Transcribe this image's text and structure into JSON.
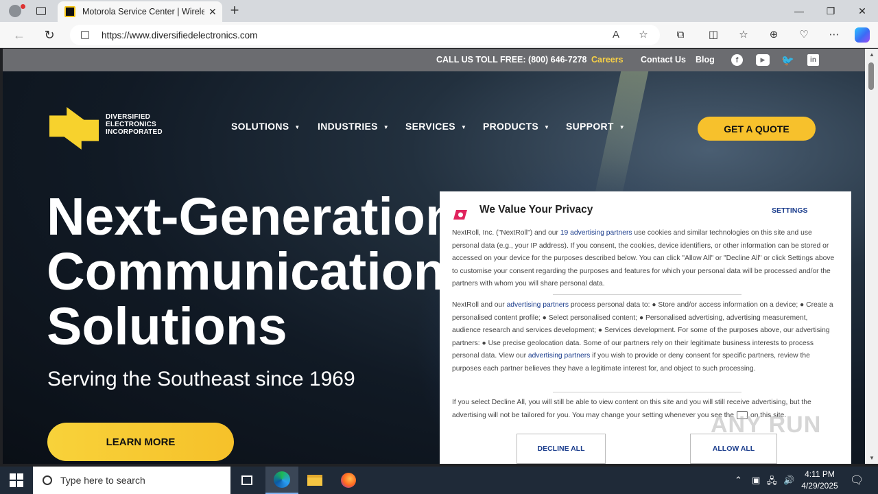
{
  "browser": {
    "tab_title": "Motorola Service Center | Wireless",
    "url": "https://www.diversifiedelectronics.com"
  },
  "site": {
    "topbar": {
      "call": "CALL US TOLL FREE: (800) 646-7278",
      "careers": "Careers",
      "contact": "Contact Us",
      "blog": "Blog"
    },
    "logo_lines": [
      "DIVERSIFIED",
      "ELECTRONICS",
      "INCORPORATED"
    ],
    "nav": [
      "SOLUTIONS",
      "INDUSTRIES",
      "SERVICES",
      "PRODUCTS",
      "SUPPORT"
    ],
    "quote": "GET A QUOTE",
    "headline": [
      "Next-Generation",
      "Communication",
      "Solutions"
    ],
    "subline": "Serving the Southeast since 1969",
    "learn_more": "LEARN MORE"
  },
  "privacy": {
    "title": "We Value Your Privacy",
    "settings": "SETTINGS",
    "p1_a": "NextRoll, Inc. (\"NextRoll\") and our ",
    "p1_link": "19 advertising partners",
    "p1_b": " use cookies and similar technologies on this site and use personal data (e.g., your IP address). If you consent, the cookies, device identifiers, or other information can be stored or accessed on your device for the purposes described below. You can click \"Allow All\" or \"Decline All\" or click Settings above to customise your consent regarding the purposes and features for which your personal data will be processed and/or the partners with whom you will share personal data.",
    "p2_a": "NextRoll and our ",
    "p2_link1": "advertising partners",
    "p2_b": " process personal data to: ● Store and/or access information on a device; ● Create a personalised content profile; ● Select personalised content; ● Personalised advertising, advertising measurement, audience research and services development; ● Services development. For some of the purposes above, our advertising partners: ● Use precise geolocation data. Some of our partners rely on their legitimate business interests to process personal data. View our ",
    "p2_link2": "advertising partners",
    "p2_c": " if you wish to provide or deny consent for specific partners, review the purposes each partner believes they have a legitimate interest for, and object to such processing.",
    "p3_a": "If you select Decline All, you will still be able to view content on this site and you will still receive advertising, but the advertising will not be tailored for you. You may change your setting whenever you see the",
    "p3_b": "on this site.",
    "decline": "DECLINE ALL",
    "allow": "ALLOW ALL"
  },
  "watermark": "ANY RUN",
  "taskbar": {
    "search_placeholder": "Type here to search",
    "time": "4:11 PM",
    "date": "4/29/2025"
  }
}
